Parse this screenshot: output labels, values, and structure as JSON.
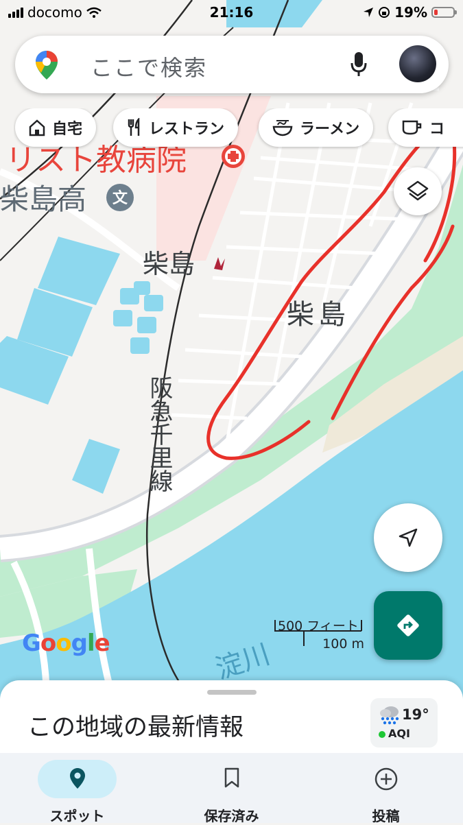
{
  "status_bar": {
    "carrier": "docomo",
    "time": "21:16",
    "battery": "19%",
    "battery_level": 0.19
  },
  "search": {
    "placeholder": "ここで検索"
  },
  "chips": [
    {
      "label": "自宅",
      "icon": "home-icon"
    },
    {
      "label": "レストラン",
      "icon": "restaurant-icon"
    },
    {
      "label": "ラーメン",
      "icon": "ramen-icon"
    },
    {
      "label": "コ",
      "icon": "coffee-icon"
    }
  ],
  "map": {
    "labels": {
      "hospital": "リスト教病院",
      "school": "柴島高",
      "station": "柴島",
      "district": "柴島",
      "rail_line": "阪急千里線",
      "river": "淀川"
    },
    "scale": {
      "feet": "500 フィート",
      "meters": "100 m"
    },
    "attribution": "Google",
    "colors": {
      "water": "#8dd8ee",
      "park": "#bfeccf",
      "road": "#ffffff",
      "hospital_area": "#fbe3e1",
      "annotation": "#e8312a"
    }
  },
  "sheet": {
    "title": "この地域の最新情報",
    "weather": {
      "temperature": "19°",
      "aqi": "AQI"
    }
  },
  "bottom_nav": [
    {
      "label": "スポット",
      "icon": "location-pin-icon",
      "selected": true
    },
    {
      "label": "保存済み",
      "icon": "bookmark-icon",
      "selected": false
    },
    {
      "label": "投稿",
      "icon": "add-circle-icon",
      "selected": false
    }
  ]
}
